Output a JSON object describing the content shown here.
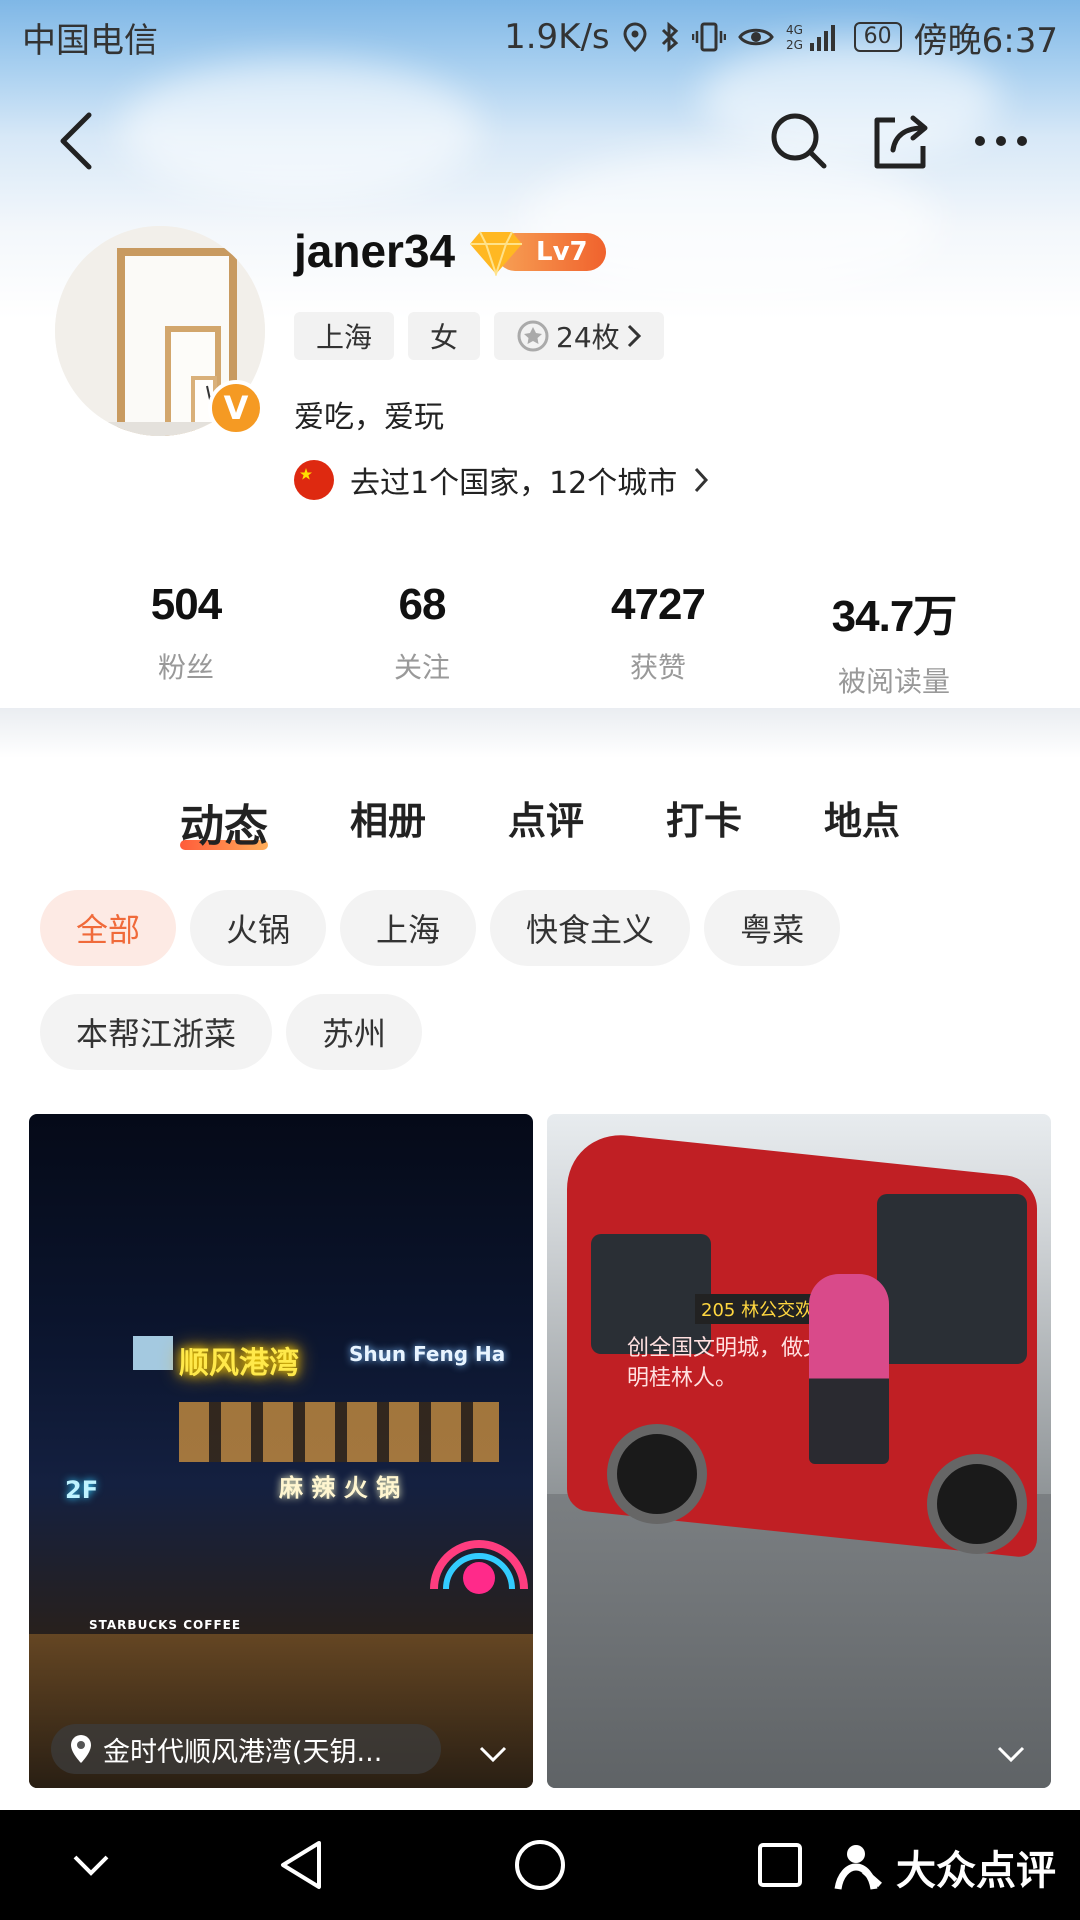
{
  "status_bar": {
    "carrier": "中国电信",
    "speed": "1.9K/s",
    "network": "4G 2G",
    "battery": "60",
    "time": "傍晚6:37"
  },
  "nav": {
    "back_icon": "back-arrow-icon",
    "search_icon": "search-icon",
    "share_icon": "share-icon",
    "more_icon": "more-icon"
  },
  "profile": {
    "username": "janer34",
    "level": "Lv7",
    "verified_badge": "V",
    "tags": [
      "上海",
      "女"
    ],
    "medals": "24枚",
    "bio": "爱吃，爱玩",
    "travel": "去过1个国家，12个城市"
  },
  "stats": [
    {
      "value": "504",
      "label": "粉丝"
    },
    {
      "value": "68",
      "label": "关注"
    },
    {
      "value": "4727",
      "label": "获赞"
    },
    {
      "value": "34.7万",
      "label": "被阅读量"
    }
  ],
  "tabs": [
    "动态",
    "相册",
    "点评",
    "打卡",
    "地点"
  ],
  "active_tab": "动态",
  "filters": [
    "全部",
    "火锅",
    "上海",
    "快食主义",
    "粤菜",
    "本帮江浙菜",
    "苏州"
  ],
  "active_filter": "全部",
  "cards": {
    "left": {
      "location": "金时代顺风港湾(天钥...",
      "sign_cn": "顺风港湾",
      "sign_en": "Shun Feng Ha",
      "sign_2f": "2F",
      "sign_hotpot": "麻 辣 火 锅",
      "starbucks": "STARBUCKS COFFEE"
    },
    "right": {
      "bus_route": "205 林公交欢迎",
      "bus_slogan": "创全国文明城，做文明桂林人。"
    }
  },
  "system_bar": {
    "watermark": "大众点评"
  },
  "colors": {
    "accent": "#f06a3a",
    "level_start": "#f7a155",
    "level_end": "#f0622d",
    "verified": "#f59a23"
  }
}
